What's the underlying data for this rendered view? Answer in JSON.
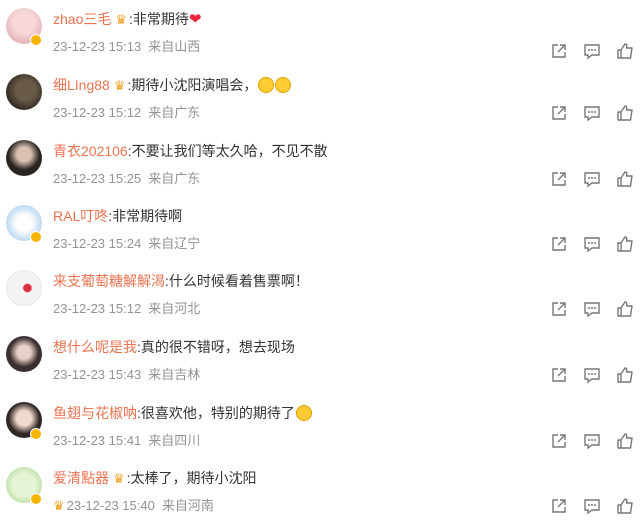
{
  "colors": {
    "username": "#eb7350",
    "meta": "#939393",
    "text": "#333333",
    "badge": "#f5b400"
  },
  "icons": {
    "crown": "crown-badge-icon",
    "verified": "verified-badge-icon",
    "forward": "forward-icon",
    "comment": "comment-icon",
    "like": "like-icon",
    "emoji": "smile-emoji-icon",
    "heart": "heart-icon"
  },
  "comments": [
    {
      "username": "zhao三毛",
      "text": ":非常期待",
      "time": "23-12-23 15:13",
      "source": "来自山西"
    },
    {
      "username": "细LIng88",
      "text": ":期待小沈阳演唱会，",
      "time": "23-12-23 15:12",
      "source": "来自广东"
    },
    {
      "username": "青衣202106",
      "text": ":不要让我们等太久哈，不见不散",
      "time": "23-12-23 15:25",
      "source": "来自广东"
    },
    {
      "username": "RAL叮咚",
      "text": ":非常期待啊",
      "time": "23-12-23 15:24",
      "source": "来自辽宁"
    },
    {
      "username": "来支葡萄糖解解渴",
      "text": ":什么时候看着售票啊！",
      "time": "23-12-23 15:12",
      "source": "来自河北"
    },
    {
      "username": "想什么呢是我",
      "text": ":真的很不错呀，想去现场",
      "time": "23-12-23 15:43",
      "source": "来自吉林"
    },
    {
      "username": "鱼翅与花椒呐",
      "text": ":很喜欢他，特别的期待了",
      "time": "23-12-23 15:41",
      "source": "来自四川"
    },
    {
      "username": "爱清點器",
      "text": ":太棒了，期待小沈阳",
      "time": "23-12-23 15:40",
      "source": "来自河南"
    }
  ]
}
